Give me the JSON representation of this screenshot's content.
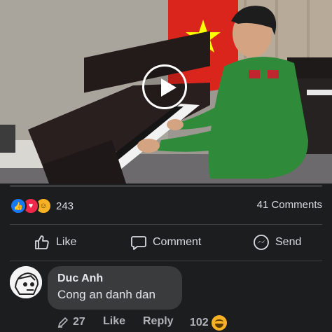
{
  "post": {
    "reaction_icons": [
      "like-icon",
      "love-icon",
      "haha-icon"
    ],
    "reaction_count": "243",
    "comments_count": "41 Comments"
  },
  "actions": {
    "like": "Like",
    "comment": "Comment",
    "send": "Send"
  },
  "comment": {
    "author": "Duc Anh",
    "text": "Cong an danh dan",
    "edit_count": "27",
    "like_label": "Like",
    "reply_label": "Reply",
    "reaction_count": "102",
    "reaction_icon": "haha-icon"
  },
  "colors": {
    "background": "#1c1d1f",
    "bubble": "#3a3b3c",
    "like_blue": "#1877f2",
    "love_red": "#f0284a",
    "haha_yellow": "#f7b125",
    "flag_red": "#da251d",
    "flag_star": "#ffff00",
    "uniform_green": "#2f8a3a"
  }
}
